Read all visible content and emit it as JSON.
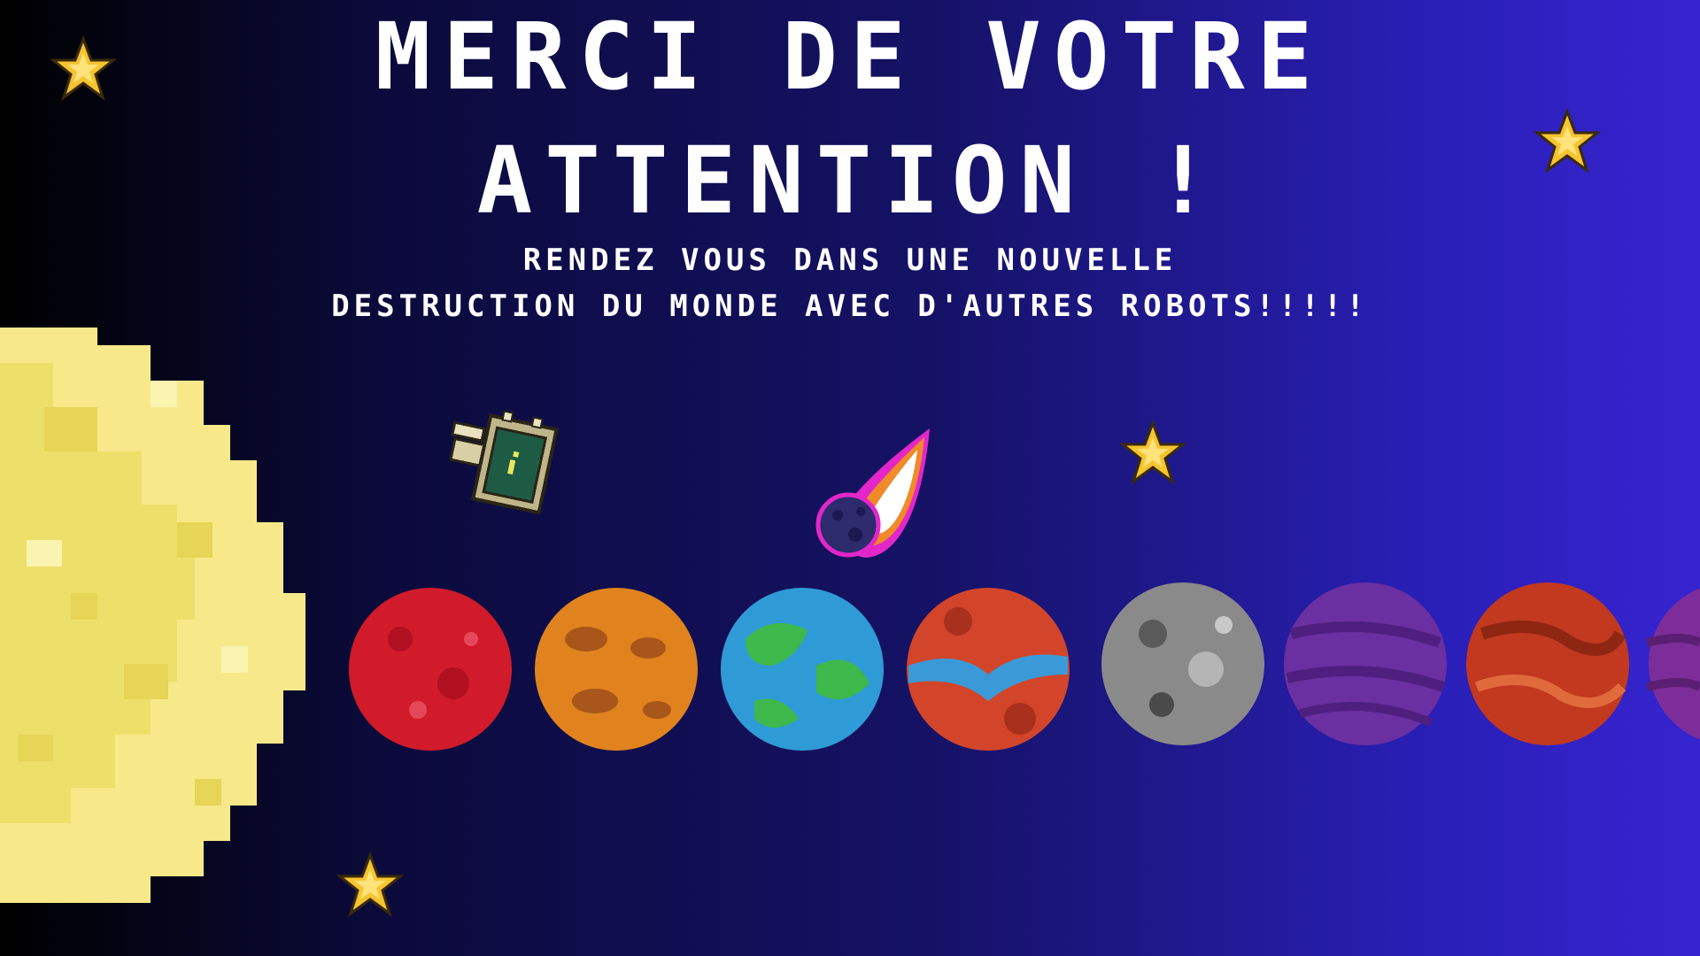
{
  "slide": {
    "title_line1": "Merci de votre",
    "title_line2": "attention !",
    "subtitle_line1": "Rendez vous dans une nouvelle",
    "subtitle_line2": "destruction du monde avec d'autres robots!!!!!"
  },
  "decorations": {
    "stars": [
      "star-icon",
      "star-icon",
      "star-icon",
      "star-icon"
    ],
    "sun": "pixel-sun",
    "robot": "pixel-robot-satellite",
    "comet": "comet-icon",
    "planets": [
      {
        "name": "red-planet",
        "color": "#d11a2a"
      },
      {
        "name": "orange-planet",
        "color": "#e0831e"
      },
      {
        "name": "earth-planet",
        "color": "#2f9bd6"
      },
      {
        "name": "lava-planet",
        "color": "#d2452a"
      },
      {
        "name": "grey-planet",
        "color": "#8a8a8a"
      },
      {
        "name": "purple-planet",
        "color": "#6a2fa0"
      },
      {
        "name": "rust-planet",
        "color": "#c2391f"
      },
      {
        "name": "violet-planet-partial",
        "color": "#7d2d9a"
      }
    ]
  },
  "colors": {
    "background_left": "#000000",
    "background_right": "#3624cf",
    "text": "#ffffff",
    "star": "#f5c431"
  }
}
